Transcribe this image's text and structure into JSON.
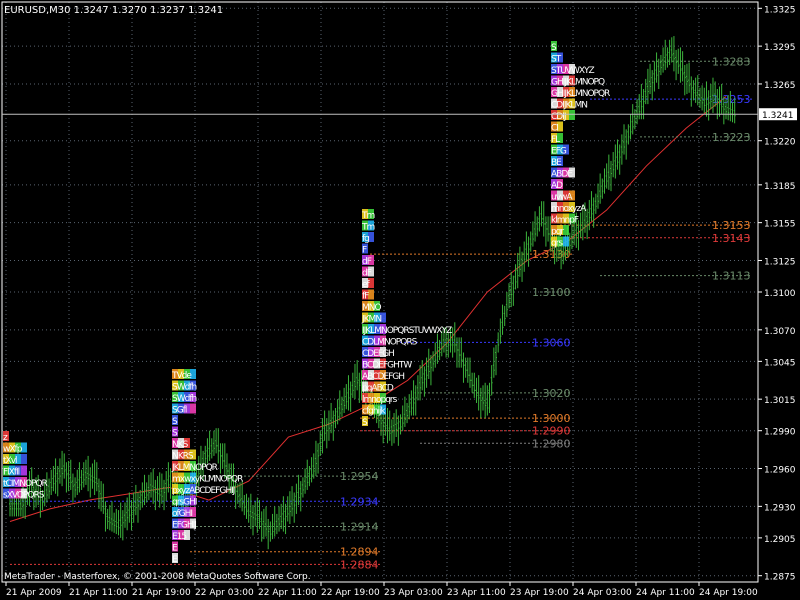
{
  "window": {
    "header": "EURUSD,M30  1.3247 1.3270 1.3237 1.3241",
    "footer": "MetaTrader - Masterforex, © 2001-2008 MetaQuotes Software Corp."
  },
  "colors": {
    "background": "#000000",
    "grid": "#5a6470",
    "axis_text": "#ffffff",
    "bid_line": "#c0c0c0",
    "candle_wick": "#3cb43c",
    "moving_average": "#e03030",
    "level_green": "#6a8a6a",
    "level_red": "#e03a3a",
    "level_orange": "#e07a2a",
    "level_blue": "#3a3aff",
    "level_gray": "#808080"
  },
  "chart_data": {
    "type": "candlestick",
    "symbol": "EURUSD",
    "timeframe": "M30",
    "ohlc_current": {
      "open": 1.3247,
      "high": 1.327,
      "low": 1.3237,
      "close": 1.3241
    },
    "current_bid": "1.3241",
    "ylim": [
      1.287,
      1.333
    ],
    "y_ticks": [
      "1.3325",
      "1.3295",
      "1.3265",
      "1.3241",
      "1.3220",
      "1.3185",
      "1.3155",
      "1.3125",
      "1.3100",
      "1.3070",
      "1.3045",
      "1.3015",
      "1.2990",
      "1.2960",
      "1.2930",
      "1.2905",
      "1.2875"
    ],
    "x_ticks": [
      "21 Apr 2009",
      "21 Apr 11:00",
      "21 Apr 19:00",
      "22 Apr 03:00",
      "22 Apr 11:00",
      "22 Apr 19:00",
      "23 Apr 03:00",
      "23 Apr 11:00",
      "23 Apr 19:00",
      "24 Apr 03:00",
      "24 Apr 11:00",
      "24 Apr 19:00"
    ],
    "grid": true,
    "close_path": [
      [
        0,
        1.293
      ],
      [
        1,
        1.2945
      ],
      [
        2,
        1.2935
      ],
      [
        3,
        1.295
      ],
      [
        4,
        1.296
      ],
      [
        5,
        1.2945
      ],
      [
        6,
        1.2955
      ],
      [
        7,
        1.295
      ],
      [
        8,
        1.292
      ],
      [
        9,
        1.2915
      ],
      [
        10,
        1.2925
      ],
      [
        11,
        1.2935
      ],
      [
        12,
        1.2945
      ],
      [
        13,
        1.294
      ],
      [
        14,
        1.2955
      ],
      [
        15,
        1.293
      ],
      [
        16,
        1.295
      ],
      [
        17,
        1.297
      ],
      [
        18,
        1.298
      ],
      [
        19,
        1.296
      ],
      [
        20,
        1.294
      ],
      [
        21,
        1.2925
      ],
      [
        22,
        1.292
      ],
      [
        23,
        1.291
      ],
      [
        24,
        1.292
      ],
      [
        25,
        1.293
      ],
      [
        26,
        1.2945
      ],
      [
        27,
        1.296
      ],
      [
        28,
        1.299
      ],
      [
        29,
        1.3
      ],
      [
        30,
        1.3015
      ],
      [
        31,
        1.303
      ],
      [
        32,
        1.302
      ],
      [
        33,
        1.3
      ],
      [
        34,
        1.299
      ],
      [
        35,
        1.2995
      ],
      [
        36,
        1.301
      ],
      [
        37,
        1.303
      ],
      [
        38,
        1.3045
      ],
      [
        39,
        1.306
      ],
      [
        40,
        1.306
      ],
      [
        41,
        1.304
      ],
      [
        42,
        1.302
      ],
      [
        43,
        1.301
      ],
      [
        44,
        1.306
      ],
      [
        45,
        1.3095
      ],
      [
        46,
        1.312
      ],
      [
        47,
        1.314
      ],
      [
        48,
        1.316
      ],
      [
        49,
        1.314
      ],
      [
        50,
        1.313
      ],
      [
        51,
        1.3145
      ],
      [
        52,
        1.3155
      ],
      [
        53,
        1.317
      ],
      [
        54,
        1.319
      ],
      [
        55,
        1.3205
      ],
      [
        56,
        1.3225
      ],
      [
        57,
        1.3245
      ],
      [
        58,
        1.3265
      ],
      [
        59,
        1.328
      ],
      [
        60,
        1.329
      ],
      [
        61,
        1.3275
      ],
      [
        62,
        1.326
      ],
      [
        63,
        1.325
      ],
      [
        64,
        1.3255
      ],
      [
        65,
        1.3245
      ],
      [
        66,
        1.3241
      ]
    ],
    "moving_average": [
      [
        0,
        1.2918
      ],
      [
        5,
        1.2928
      ],
      [
        10,
        1.2935
      ],
      [
        15,
        1.294
      ],
      [
        20,
        1.2945
      ],
      [
        25,
        1.2935
      ],
      [
        30,
        1.295
      ],
      [
        35,
        1.2985
      ],
      [
        40,
        1.2995
      ],
      [
        45,
        1.301
      ],
      [
        50,
        1.303
      ],
      [
        55,
        1.306
      ],
      [
        60,
        1.31
      ],
      [
        65,
        1.3125
      ],
      [
        70,
        1.314
      ],
      [
        75,
        1.3165
      ],
      [
        80,
        1.32
      ],
      [
        85,
        1.323
      ],
      [
        90,
        1.3255
      ]
    ],
    "levels": [
      {
        "label": "1.3283",
        "value": 1.3283,
        "color": "green"
      },
      {
        "label": "1.3253",
        "value": 1.3253,
        "color": "blue"
      },
      {
        "label": "1.3223",
        "value": 1.3223,
        "color": "green"
      },
      {
        "label": "1.3153",
        "value": 1.3153,
        "color": "orange"
      },
      {
        "label": "1.3143",
        "value": 1.3143,
        "color": "red"
      },
      {
        "label": "1.3130",
        "value": 1.313,
        "color": "orange"
      },
      {
        "label": "1.3113",
        "value": 1.3113,
        "color": "green"
      },
      {
        "label": "1.3100",
        "value": 1.31,
        "color": "green"
      },
      {
        "label": "1.3060",
        "value": 1.306,
        "color": "blue"
      },
      {
        "label": "1.3020",
        "value": 1.302,
        "color": "green"
      },
      {
        "label": "1.3000",
        "value": 1.3,
        "color": "orange"
      },
      {
        "label": "1.2990",
        "value": 1.299,
        "color": "red"
      },
      {
        "label": "1.2980",
        "value": 1.298,
        "color": "gray"
      },
      {
        "label": "1.2954",
        "value": 1.2954,
        "color": "green"
      },
      {
        "label": "1.2934",
        "value": 1.2934,
        "color": "blue"
      },
      {
        "label": "1.2914",
        "value": 1.2914,
        "color": "green"
      },
      {
        "label": "1.2894",
        "value": 1.2894,
        "color": "orange"
      },
      {
        "label": "1.2884",
        "value": 1.2884,
        "color": "red"
      }
    ],
    "market_profile_letters": [
      {
        "session": "21 Apr",
        "rows": [
          "z",
          "wXfp",
          "tXvl",
          "FlXfIl",
          "tCIMNOPQR",
          "sXVOPQRS"
        ]
      },
      {
        "session": "22 Apr",
        "rows": [
          "TVde",
          "SWdfh",
          "SWdfh",
          "SGfl",
          "S",
          "S",
          "NKS",
          "NKRS",
          "JKLMNOPQR",
          "mxwxyKLMNOPQR",
          "pxyzABCDEFGHIJ",
          "qrsGHI",
          "ofGHI",
          "EFGHIJ",
          "E15",
          "E",
          "E"
        ]
      },
      {
        "session": "23 Apr",
        "rows": [
          "Tm",
          "Tm",
          "fg",
          "F",
          "dF",
          "dF",
          "ef",
          "fF",
          "MNO",
          "JKMN",
          "IJKLMNOPQRSTUVWXYZ",
          "CDLMNOPQRS",
          "CDEFGH",
          "BCDEFGHTW",
          "ABCDEFGH",
          "pqABCD",
          "lmnopqrs",
          "cfghijk",
          "S"
        ]
      },
      {
        "session": "24 Apr",
        "rows": [
          "S",
          "ST",
          "STUVWXYZ",
          "GHIJKLMNOPQ",
          "GHIJKLMNOPQR",
          "CDIJKLMN",
          "CDIJ",
          "CI",
          "FL",
          "EFG",
          "BE",
          "ABDE",
          "AD",
          "uvwA",
          "mnoxyzA",
          "klmnpF",
          "pqr",
          "qrs"
        ]
      }
    ]
  }
}
